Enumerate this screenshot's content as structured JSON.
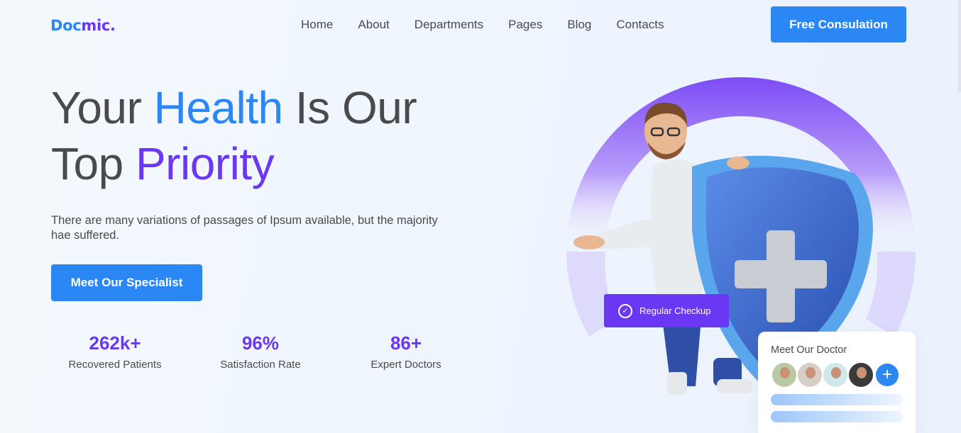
{
  "brand": {
    "logo_part1": "Doc",
    "logo_part2": "mic."
  },
  "nav": {
    "items": [
      "Home",
      "About",
      "Departments",
      "Pages",
      "Blog",
      "Contacts"
    ],
    "cta_label": "Free Consulation"
  },
  "hero": {
    "headline_w1": "Your ",
    "headline_w2": "Health",
    "headline_w3": " Is Our",
    "headline_w4": "Top ",
    "headline_w5": "Priority",
    "subtitle": "There are many variations of passages of Ipsum available, but the majority hae suffered.",
    "cta_label": "Meet Our Specialist"
  },
  "stats": [
    {
      "value": "262k+",
      "label": "Recovered Patients"
    },
    {
      "value": "96%",
      "label": "Satisfaction Rate"
    },
    {
      "value": "86+",
      "label": "Expert Doctors"
    }
  ],
  "badge": {
    "label": "Regular Checkup"
  },
  "doctor_card": {
    "title": "Meet Our Doctor",
    "plus": "+"
  },
  "colors": {
    "primary": "#2b87f3",
    "accent": "#6a37f5",
    "text": "#4a4a4a"
  }
}
